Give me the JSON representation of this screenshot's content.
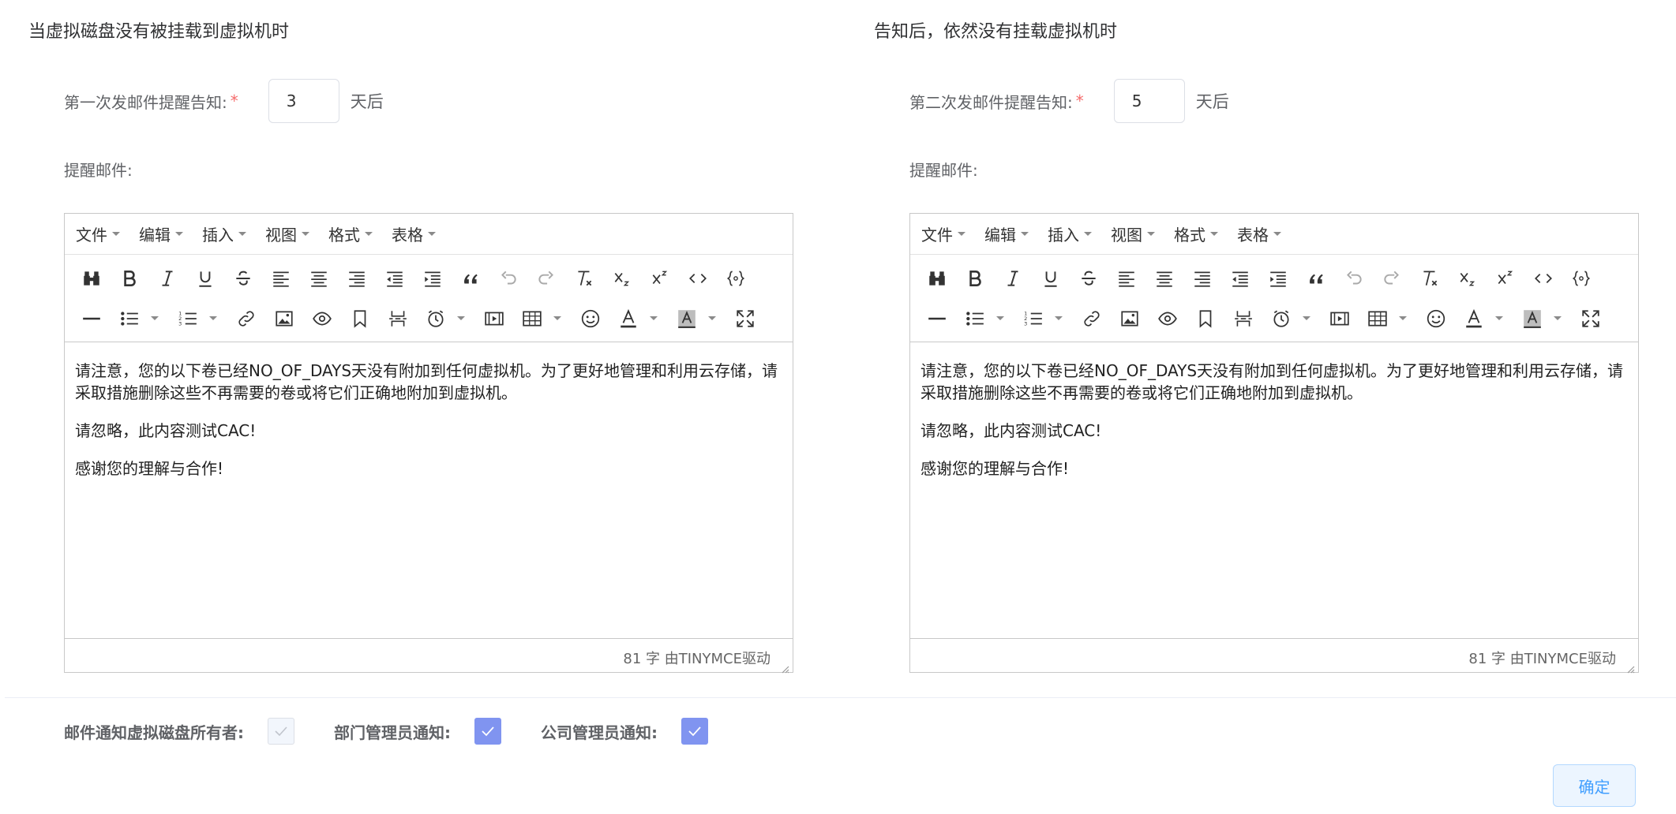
{
  "left": {
    "section_title": "当虚拟磁盘没有被挂载到虚拟机时",
    "field_label": "第一次发邮件提醒告知:",
    "required_mark": "*",
    "days_value": "3",
    "unit": "天后",
    "mail_label": "提醒邮件:",
    "editor": {
      "paragraph1": "请注意，您的以下卷已经NO_OF_DAYS天没有附加到任何虚拟机。为了更好地管理和利用云存储，请采取措施删除这些不再需要的卷或将它们正确地附加到虚拟机。",
      "paragraph2": "请忽略，此内容测试CAC!",
      "paragraph3": "感谢您的理解与合作!",
      "status": "81 字 由TINYMCE驱动"
    }
  },
  "right": {
    "section_title": "告知后，依然没有挂载虚拟机时",
    "field_label": "第二次发邮件提醒告知:",
    "required_mark": "*",
    "days_value": "5",
    "unit": "天后",
    "mail_label": "提醒邮件:",
    "editor": {
      "paragraph1": "请注意，您的以下卷已经NO_OF_DAYS天没有附加到任何虚拟机。为了更好地管理和利用云存储，请采取措施删除这些不再需要的卷或将它们正确地附加到虚拟机。",
      "paragraph2": "请忽略，此内容测试CAC!",
      "paragraph3": "感谢您的理解与合作!",
      "status": "81 字 由TINYMCE驱动"
    }
  },
  "menus": {
    "file": "文件",
    "edit": "编辑",
    "insert": "插入",
    "view": "视图",
    "format": "格式",
    "table": "表格"
  },
  "toolbar_icons": {
    "row1": [
      "find-replace-icon",
      "bold-icon",
      "italic-icon",
      "underline-icon",
      "strikethrough-icon",
      "align-left-icon",
      "align-center-icon",
      "align-right-icon",
      "outdent-icon",
      "indent-icon",
      "blockquote-icon",
      "undo-icon",
      "redo-icon",
      "clear-format-icon",
      "subscript-icon",
      "superscript-icon",
      "code-icon",
      "template-icon"
    ],
    "row2": [
      "horizontal-rule-icon",
      "bullet-list-icon",
      "numbered-list-icon",
      "link-icon",
      "image-icon",
      "preview-icon",
      "bookmark-icon",
      "page-break-icon",
      "insert-time-icon",
      "media-icon",
      "table-icon",
      "emoticons-icon",
      "text-color-icon",
      "background-color-icon",
      "fullscreen-icon"
    ]
  },
  "notifications": {
    "owner_label": "邮件通知虚拟磁盘所有者:",
    "owner_checked": true,
    "owner_disabled": true,
    "dept_label": "部门管理员通知:",
    "dept_checked": true,
    "company_label": "公司管理员通知:",
    "company_checked": true
  },
  "confirm_label": "确定",
  "colors": {
    "checkbox_checked": "#8094f0",
    "required": "#f56c6c",
    "confirm_text": "#409eff",
    "confirm_bg": "#ecf5ff"
  }
}
